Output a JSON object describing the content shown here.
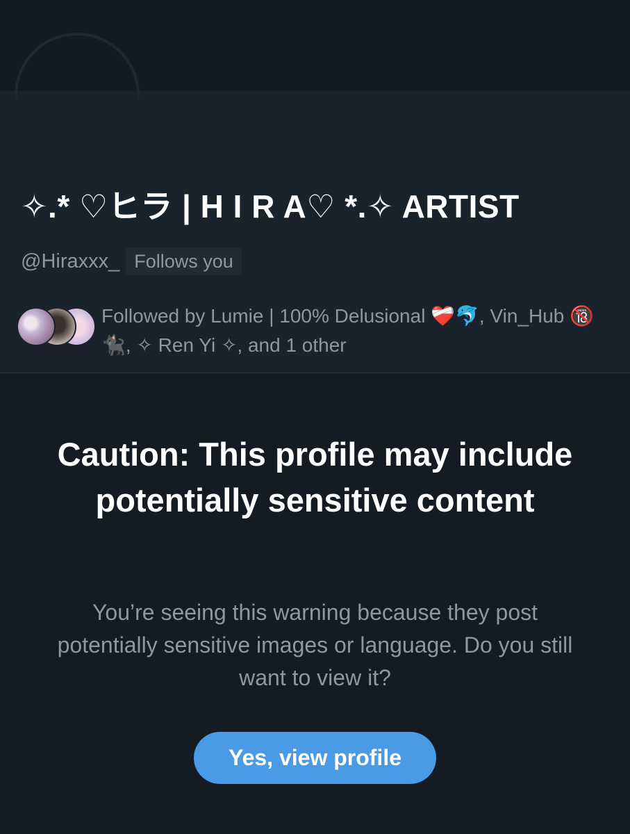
{
  "profile": {
    "display_name": "✧.* ♡ヒラ | H I R A♡ *.✧ ARTIST",
    "handle": "@Hiraxxx_",
    "follows_badge": "Follows you",
    "followed_by_text": "Followed by Lumie | 100% Delusional ❤️‍🩹🐬, Vin_Hub 🔞 🐈‍⬛, ✧ Ren Yi ✧, and 1 other"
  },
  "warning": {
    "title": "Caution: This profile may include potentially sensitive content",
    "body": "You’re seeing this warning because they post potentially sensitive images or language. Do you still want to view it?",
    "button_label": "Yes, view profile"
  },
  "colors": {
    "background": "#151b23",
    "card": "#1a222b",
    "accent": "#4a9ae6",
    "muted_text": "#8b98a5"
  }
}
